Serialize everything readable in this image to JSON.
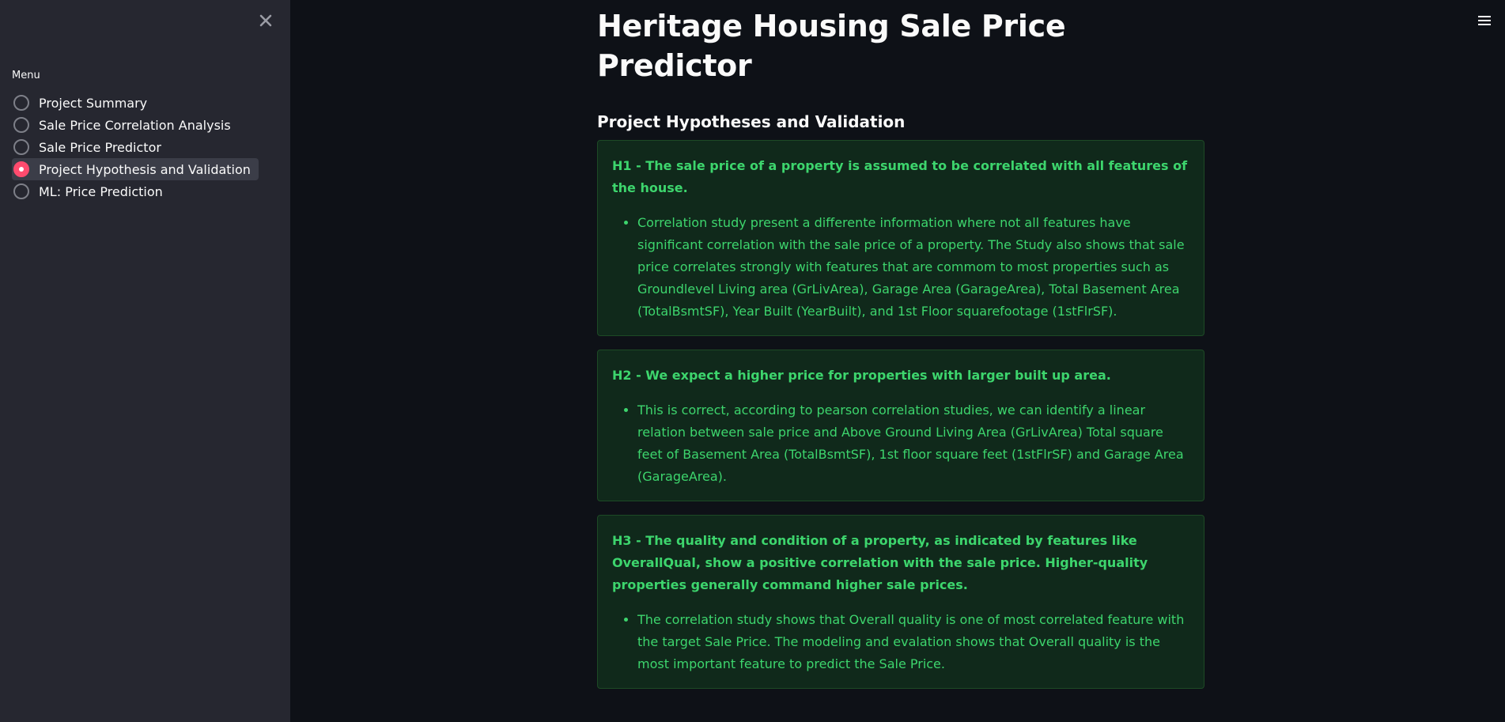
{
  "sidebar": {
    "menu_label": "Menu",
    "items": [
      {
        "label": "Project Summary",
        "selected": false
      },
      {
        "label": "Sale Price Correlation Analysis",
        "selected": false
      },
      {
        "label": "Sale Price Predictor",
        "selected": false
      },
      {
        "label": "Project Hypothesis and Validation",
        "selected": true
      },
      {
        "label": "ML: Price Prediction",
        "selected": false
      }
    ],
    "close_icon": "close-icon"
  },
  "header": {
    "menu_icon": "hamburger-menu-icon"
  },
  "main": {
    "title": "Heritage Housing Sale Price Predictor",
    "subheader": "Project Hypotheses and Validation",
    "cards": [
      {
        "heading": "H1 - The sale price of a property is assumed to be correlated with all features of the house.",
        "bullet": "Correlation study present a differente information where not all features have significant correlation with the sale price of a property. The Study also shows that sale price correlates strongly with features that are commom to most properties such as Groundlevel Living area (GrLivArea), Garage Area (GarageArea), Total Basement Area (TotalBsmtSF), Year Built (YearBuilt), and 1st Floor squarefootage (1stFlrSF)."
      },
      {
        "heading": "H2 - We expect a higher price for properties with larger built up area.",
        "bullet": "This is correct, according to pearson correlation studies, we can identify a linear relation between sale price and Above Ground Living Area (GrLivArea) Total square feet of Basement Area (TotalBsmtSF), 1st floor square feet (1stFlrSF) and Garage Area (GarageArea)."
      },
      {
        "heading": "H3 - The quality and condition of a property, as indicated by features like OverallQual, show a positive correlation with the sale price. Higher-quality properties generally command higher sale prices.",
        "bullet": "The correlation study shows that Overall quality is one of most correlated feature with the target Sale Price. The modeling and evalation shows that Overall quality is the most important feature to predict the Sale Price."
      }
    ]
  },
  "colors": {
    "background": "#0e1117",
    "sidebar": "#262730",
    "accent": "#ff4b6e",
    "success_text": "#3dd56d"
  }
}
